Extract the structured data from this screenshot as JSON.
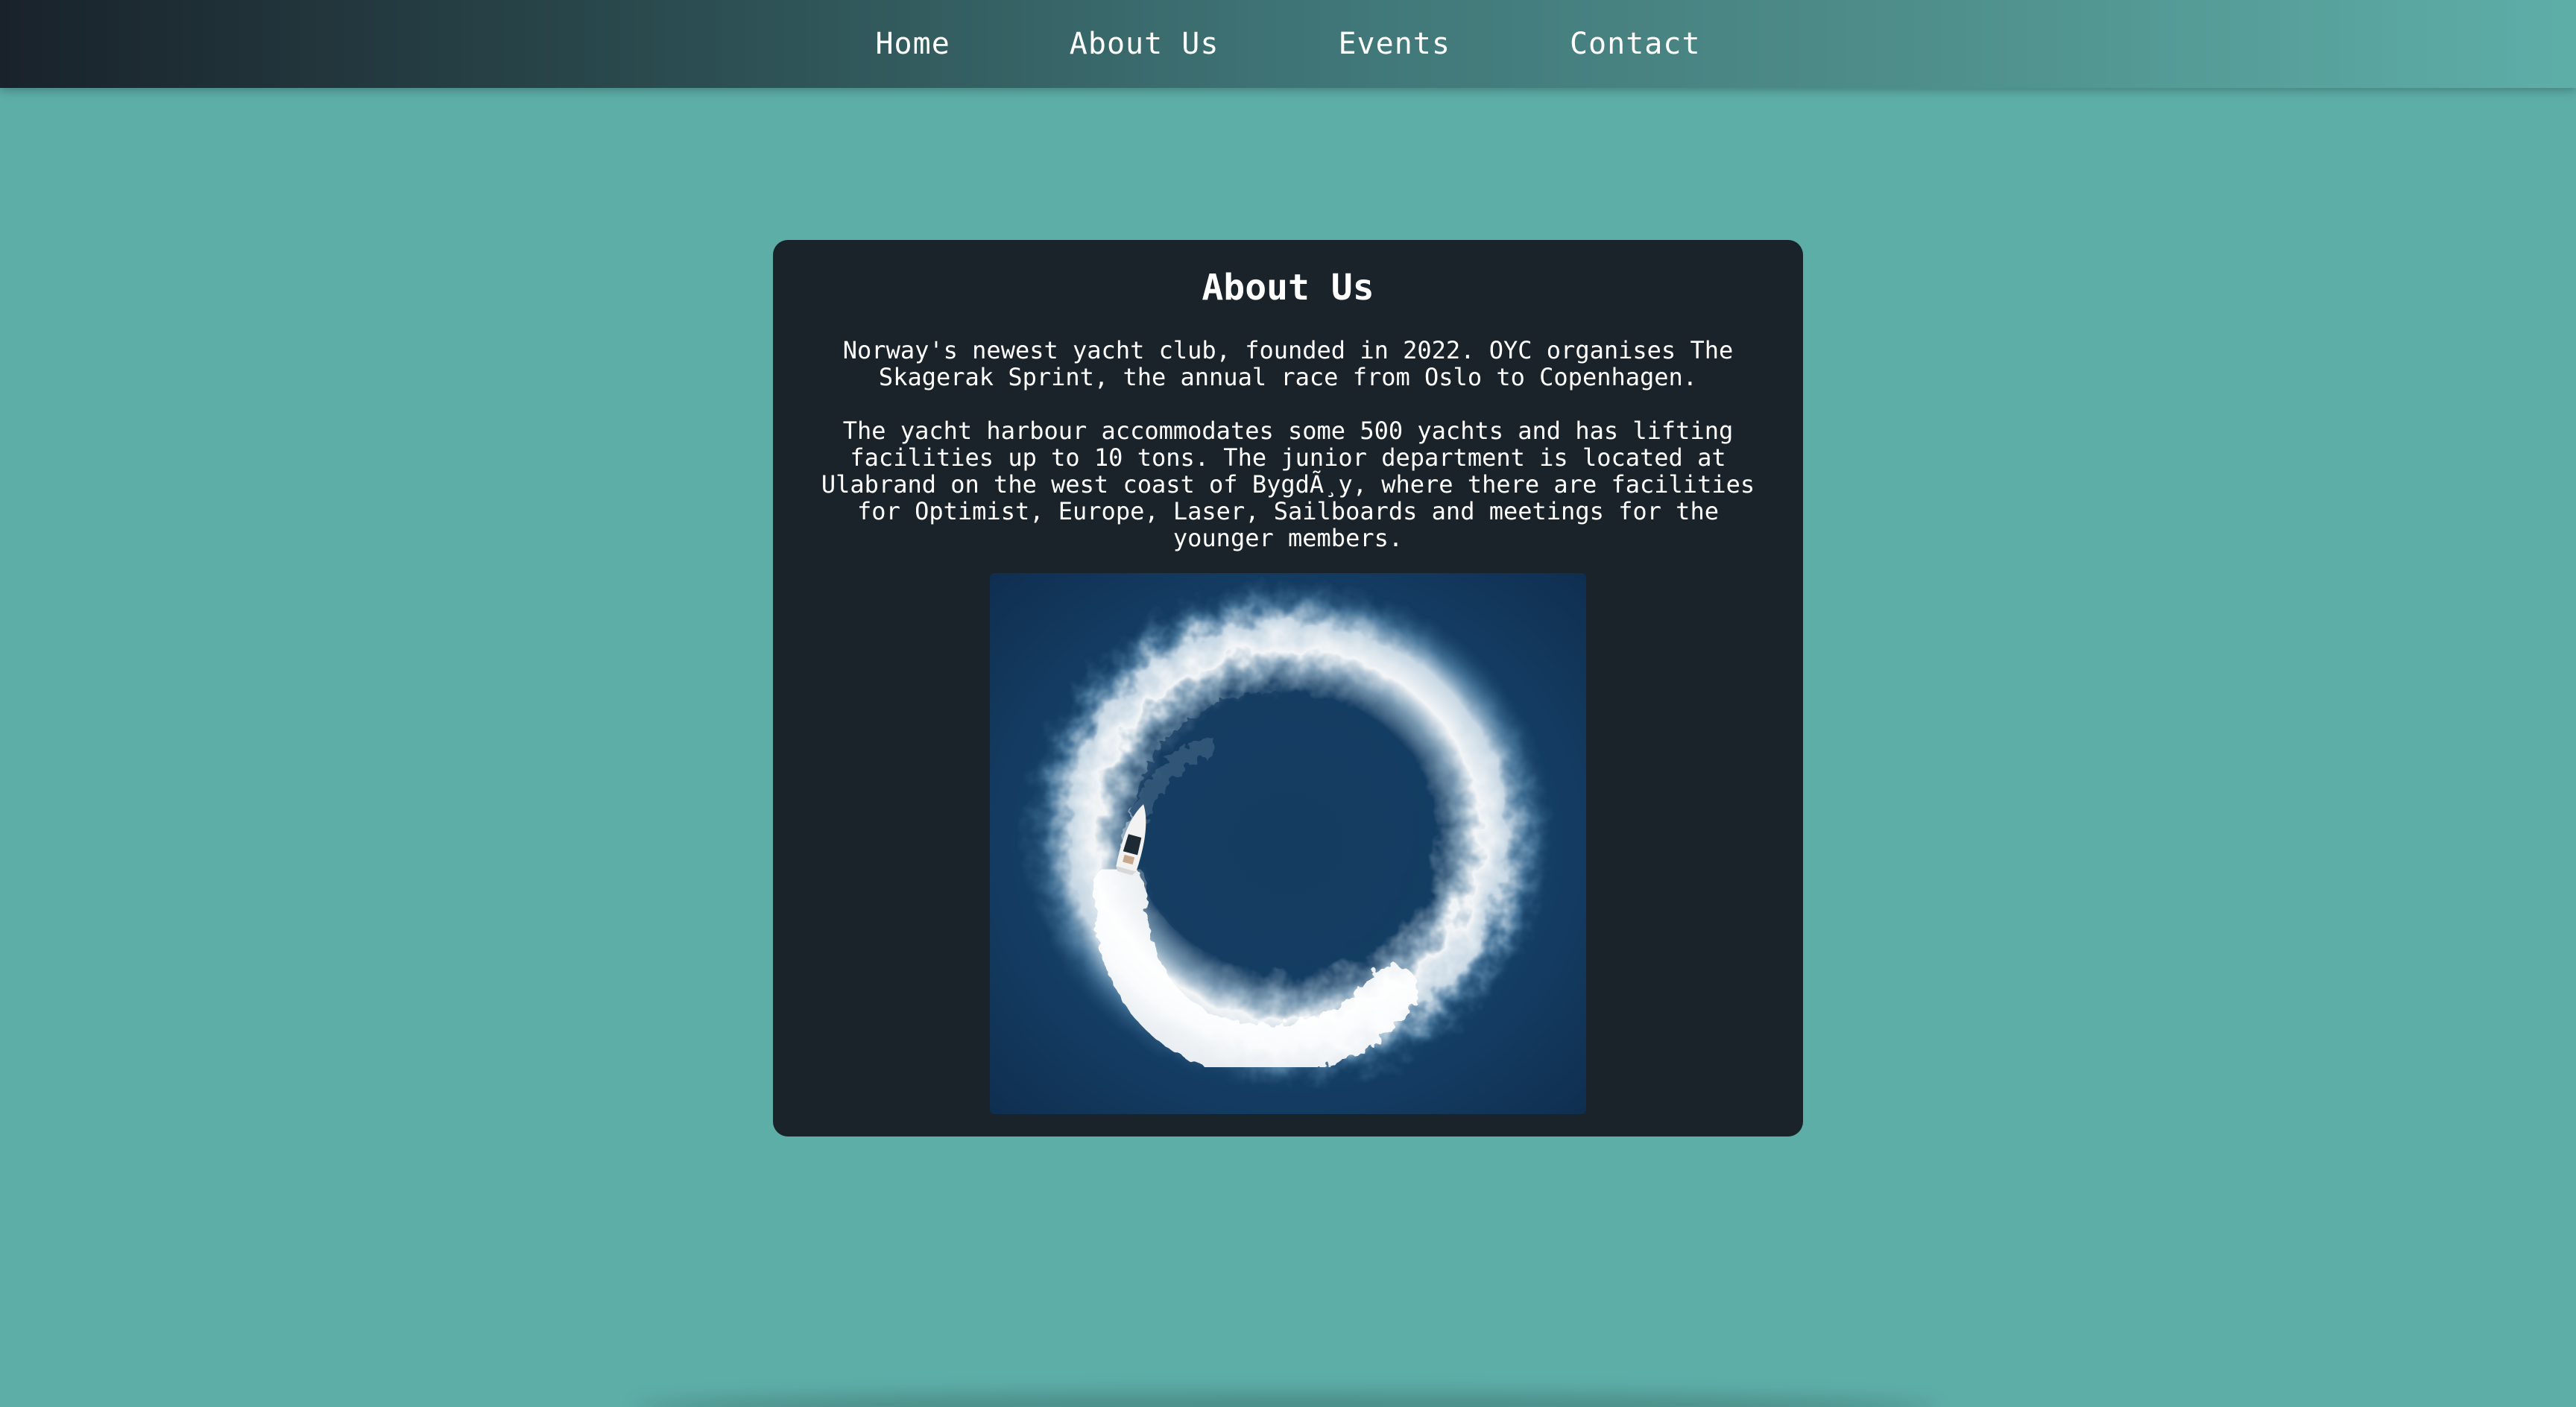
{
  "nav": {
    "items": [
      {
        "label": "Home"
      },
      {
        "label": "About Us"
      },
      {
        "label": "Events"
      },
      {
        "label": "Contact"
      }
    ]
  },
  "about": {
    "title": "About Us",
    "paragraph1": "Norway's newest yacht club, founded in 2022. OYC organises The Skagerak Sprint, the annual race from Oslo to Copenhagen.",
    "paragraph2": "The yacht harbour accommodates some 500 yachts and has lifting facilities up to 10 tons. The junior department is located at Ulabrand on the west coast of BygdÃ¸y, where there are facilities for Optimist, Europe, Laser, Sailboards and meetings for the younger members.",
    "image": "yacht-circle-photo"
  },
  "colors": {
    "background": "#5eaea8",
    "card": "#1a2329",
    "nav_start": "#19222a",
    "text": "#ffffff"
  }
}
